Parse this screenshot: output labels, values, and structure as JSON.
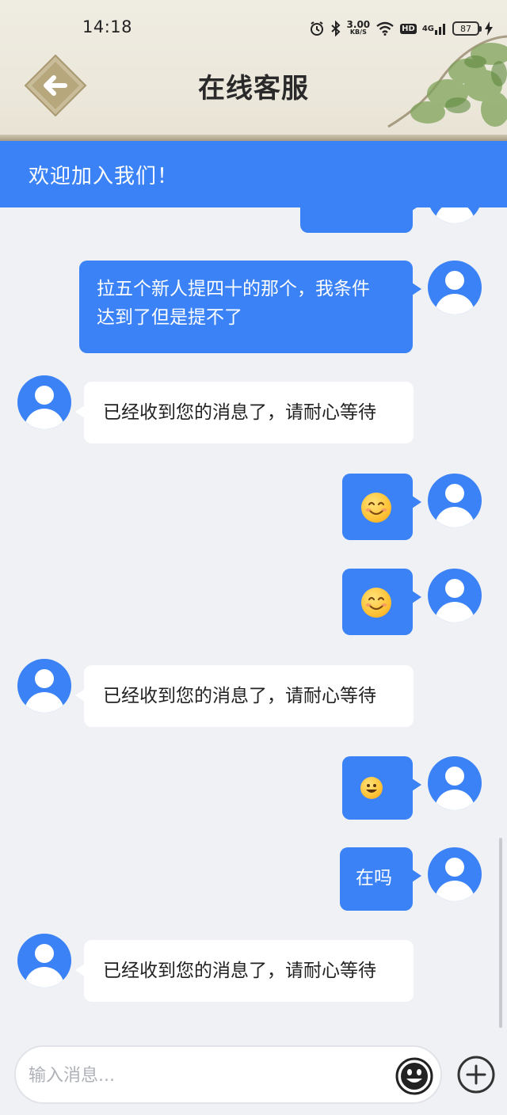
{
  "status_bar": {
    "time": "14:18",
    "net_speed_value": "3.00",
    "net_speed_unit": "KB/S",
    "hd_badge": "HD",
    "network_type": "4G",
    "battery": "87"
  },
  "header": {
    "title": "在线客服"
  },
  "banner": {
    "text": "欢迎加入我们！"
  },
  "messages": [
    {
      "sender": "user",
      "type": "text",
      "text": ""
    },
    {
      "sender": "user",
      "type": "text",
      "lines": [
        "拉五个新人提四十的那个，我条件",
        "达到了但是提不了"
      ]
    },
    {
      "sender": "agent",
      "type": "text",
      "text": "已经收到您的消息了，请耐心等待"
    },
    {
      "sender": "user",
      "type": "emoji",
      "emoji": "smiling-face-icon"
    },
    {
      "sender": "user",
      "type": "emoji",
      "emoji": "smiling-face-icon"
    },
    {
      "sender": "agent",
      "type": "text",
      "text": "已经收到您的消息了，请耐心等待"
    },
    {
      "sender": "user",
      "type": "emoji",
      "emoji": "grinning-face-icon"
    },
    {
      "sender": "user",
      "type": "text",
      "text": "在吗"
    },
    {
      "sender": "agent",
      "type": "text",
      "text": "已经收到您的消息了，请耐心等待"
    }
  ],
  "composer": {
    "placeholder": "输入消息...",
    "emoji_button_icon": "emoji-icon",
    "add_button_icon": "plus-icon"
  },
  "colors": {
    "accent": "#3a82f5",
    "chat_background": "#f0f1f5",
    "header_background": "#ece8dc"
  }
}
